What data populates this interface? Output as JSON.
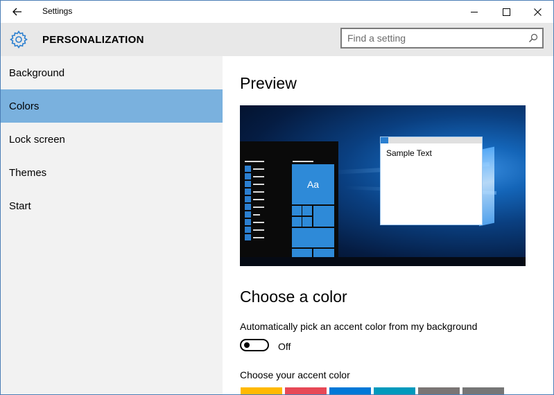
{
  "window": {
    "title": "Settings"
  },
  "header": {
    "page_title": "PERSONALIZATION",
    "search_placeholder": "Find a setting"
  },
  "sidebar": {
    "items": [
      {
        "label": "Background",
        "active": false
      },
      {
        "label": "Colors",
        "active": true
      },
      {
        "label": "Lock screen",
        "active": false
      },
      {
        "label": "Themes",
        "active": false
      },
      {
        "label": "Start",
        "active": false
      }
    ]
  },
  "main": {
    "preview_heading": "Preview",
    "preview": {
      "tile_text": "Aa",
      "sample_text": "Sample Text"
    },
    "choose_color_heading": "Choose a color",
    "auto_accent_label": "Automatically pick an accent color from my background",
    "auto_accent_state": "Off",
    "accent_label": "Choose your accent color",
    "accent_colors": [
      "#ffb900",
      "#e74856",
      "#0078d7",
      "#0099bc",
      "#7a7574",
      "#767676"
    ]
  },
  "colors": {
    "accent": "#7ab1de",
    "sidebar_bg": "#f2f2f2",
    "header_bg": "#e8e8e8"
  }
}
